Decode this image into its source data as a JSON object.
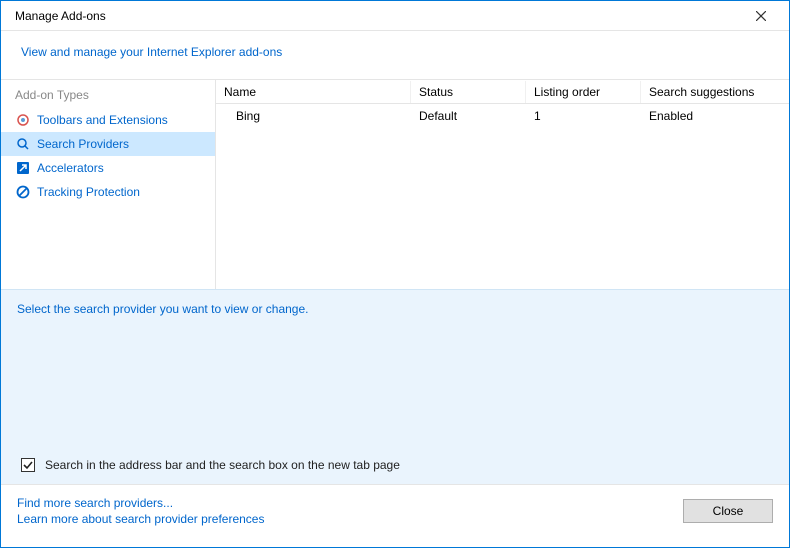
{
  "titlebar": {
    "title": "Manage Add-ons"
  },
  "subheader": {
    "text": "View and manage your Internet Explorer add-ons"
  },
  "sidebar": {
    "header": "Add-on Types",
    "items": [
      {
        "label": "Toolbars and Extensions"
      },
      {
        "label": "Search Providers"
      },
      {
        "label": "Accelerators"
      },
      {
        "label": "Tracking Protection"
      }
    ]
  },
  "table": {
    "headers": {
      "name": "Name",
      "status": "Status",
      "order": "Listing order",
      "sugg": "Search suggestions"
    },
    "rows": [
      {
        "name": "Bing",
        "status": "Default",
        "order": "1",
        "sugg": "Enabled"
      }
    ]
  },
  "detail": {
    "hint": "Select the search provider you want to view or change.",
    "checkbox_label": "Search in the address bar and the search box on the new tab page"
  },
  "footer": {
    "link1": "Find more search providers...",
    "link2": "Learn more about search provider preferences",
    "close": "Close"
  }
}
